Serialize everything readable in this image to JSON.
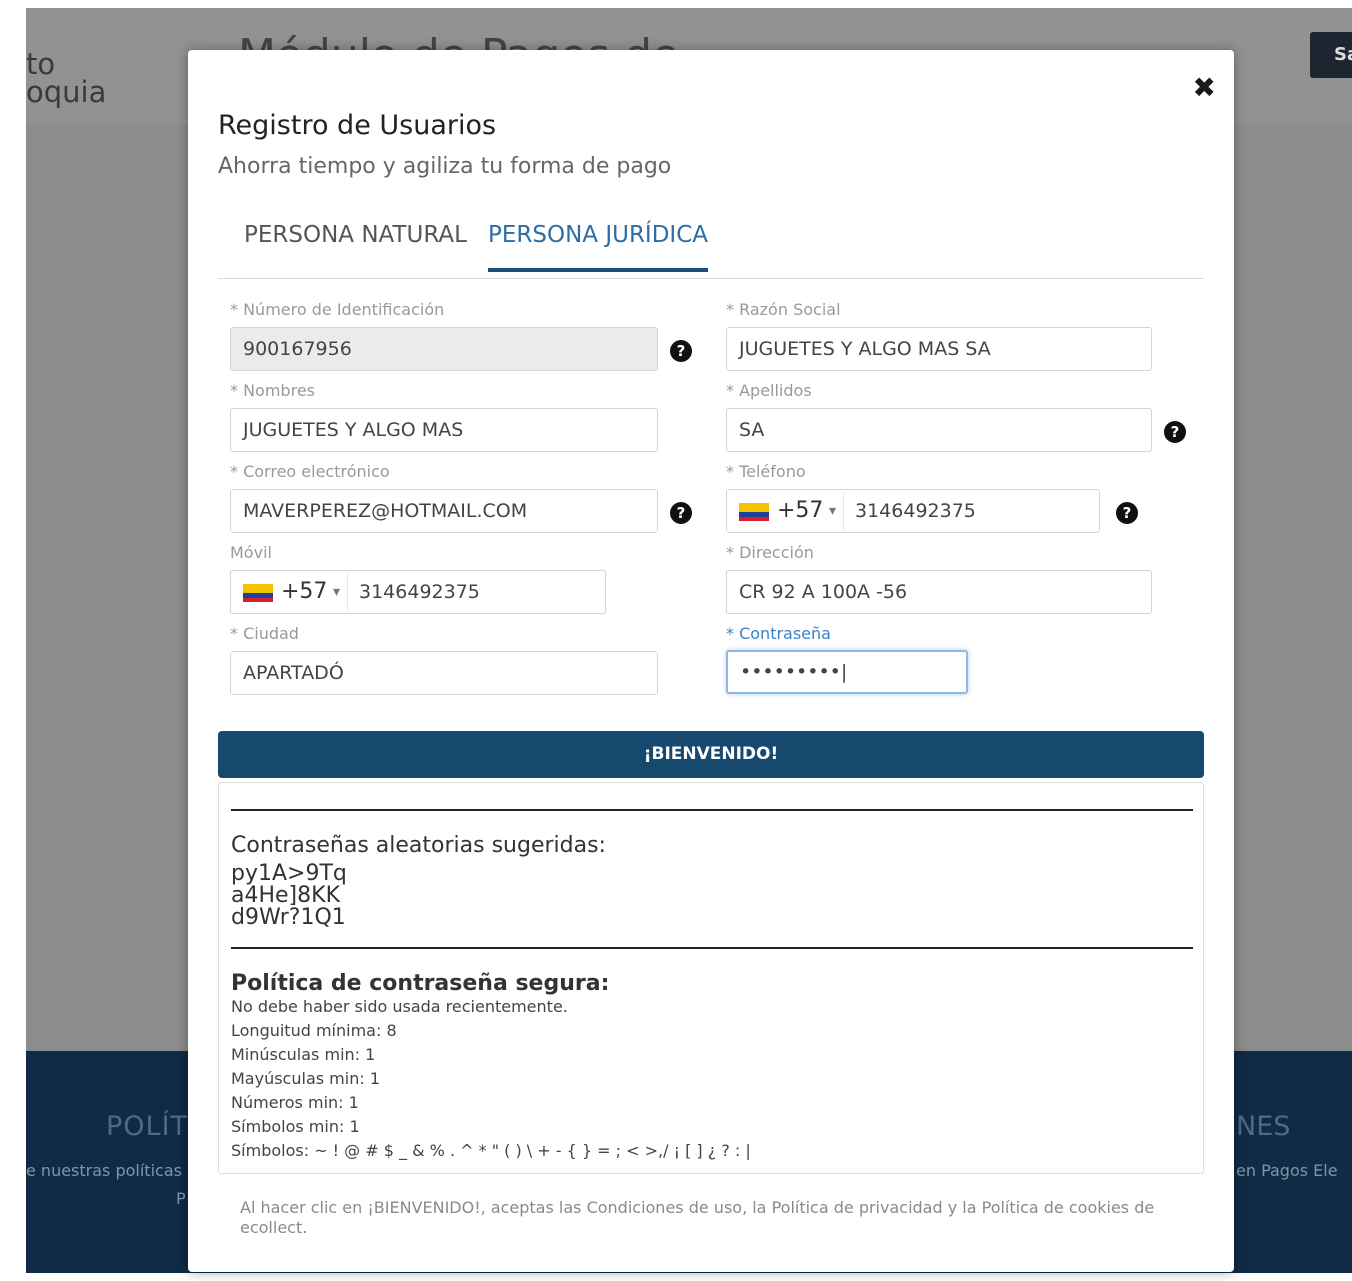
{
  "background": {
    "logo_line1": "to",
    "logo_line2": "oquia",
    "module_title": "Módulo de Pagos de",
    "header_button": "Sa",
    "footer_heading_left": "POLÍT",
    "footer_text_left": "e nuestras políticas",
    "footer_text_left2": "P",
    "footer_heading_right": "NES",
    "footer_text_right": "en Pagos Ele"
  },
  "modal": {
    "close_label": "✖",
    "title": "Registro de Usuarios",
    "subtitle": "Ahorra tiempo y agiliza tu forma de pago",
    "tabs": [
      {
        "label": "PERSONA NATURAL",
        "active": false
      },
      {
        "label": "PERSONA JURÍDICA",
        "active": true
      }
    ]
  },
  "form": {
    "id_number": {
      "label": "* Número de Identificación",
      "value": "900167956"
    },
    "razon_social": {
      "label": "* Razón Social",
      "value": "JUGUETES Y ALGO MAS SA"
    },
    "nombres": {
      "label": "* Nombres",
      "value": "JUGUETES Y ALGO MAS"
    },
    "apellidos": {
      "label": "* Apellidos",
      "value": "SA"
    },
    "email": {
      "label": "* Correo electrónico",
      "value": "MAVERPEREZ@HOTMAIL.COM"
    },
    "telefono": {
      "label": "* Teléfono",
      "dial_code": "+57",
      "caret": "▾",
      "value": "3146492375"
    },
    "movil": {
      "label": "Móvil",
      "dial_code": "+57",
      "caret": "▾",
      "value": "3146492375"
    },
    "direccion": {
      "label": "* Dirección",
      "value": "CR 92 A 100A -56"
    },
    "ciudad": {
      "label": "* Ciudad",
      "value": "APARTADÓ"
    },
    "contrasena": {
      "label": "* Contraseña",
      "value": "•••••••••|"
    },
    "help_icon": "?"
  },
  "submit_label": "¡BIENVENIDO!",
  "password_panel": {
    "suggest_title": "Contraseñas aleatorias sugeridas:",
    "suggestions": [
      "py1A>9Tq",
      "a4He]8KK",
      "d9Wr?1Q1"
    ],
    "policy_title": "Política de contraseña segura:",
    "policy_lines": [
      "No debe haber sido usada recientemente.",
      "Longuitud mínima: 8",
      "Minúsculas min: 1",
      "Mayúsculas min: 1",
      "Números min: 1",
      "Símbolos min: 1",
      "Símbolos: ~ ! @ # $ _ & % . ^ * \" ( ) \\ + - { } = ; < >,/ ¡ [ ] ¿ ? : |"
    ]
  },
  "legal_text": "Al hacer clic en ¡BIENVENIDO!, aceptas las Condiciones de uso, la Política de privacidad y la Política de cookies de ecollect.",
  "colors": {
    "accent": "#17496f",
    "tab_active": "#2d6da3",
    "overlay": "#8c8c8c",
    "footer": "#0f2b45"
  }
}
